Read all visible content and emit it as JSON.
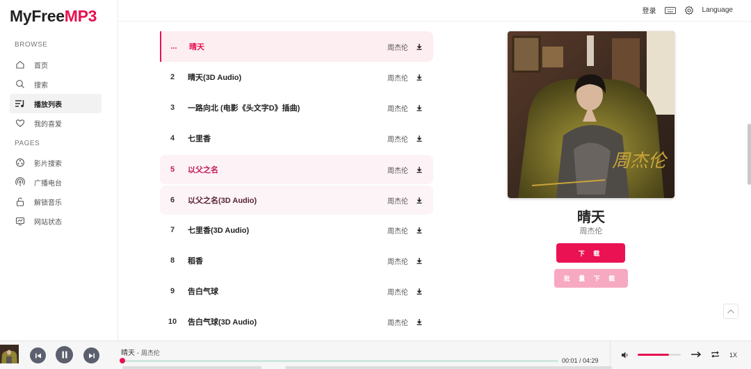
{
  "logo": {
    "text_main": "MyFree",
    "text_accent": "MP3"
  },
  "sidebar": {
    "browse_label": "BROWSE",
    "pages_label": "PAGES",
    "browse_items": [
      {
        "label": "首页",
        "icon": "home-icon"
      },
      {
        "label": "搜索",
        "icon": "search-icon"
      },
      {
        "label": "播放列表",
        "icon": "playlist-icon",
        "active": true
      },
      {
        "label": "我的喜爱",
        "icon": "heart-icon"
      }
    ],
    "page_items": [
      {
        "label": "影片搜索",
        "icon": "film-reel-icon"
      },
      {
        "label": "广播电台",
        "icon": "radio-icon"
      },
      {
        "label": "解锁音乐",
        "icon": "unlock-icon"
      },
      {
        "label": "网站状态",
        "icon": "monitor-icon"
      }
    ]
  },
  "topbar": {
    "login": "登录",
    "keyboard_icon": "keyboard-icon",
    "settings_icon": "gear-icon",
    "language": "Language"
  },
  "songs": [
    {
      "num": "...",
      "title": "晴天",
      "artist": "周杰伦"
    },
    {
      "num": "2",
      "title": "晴天(3D Audio)",
      "artist": "周杰伦"
    },
    {
      "num": "3",
      "title": "一路向北 (电影《头文字D》插曲)",
      "artist": "周杰伦"
    },
    {
      "num": "4",
      "title": "七里香",
      "artist": "周杰伦"
    },
    {
      "num": "5",
      "title": "以父之名",
      "artist": "周杰伦"
    },
    {
      "num": "6",
      "title": "以父之名(3D Audio)",
      "artist": "周杰伦"
    },
    {
      "num": "7",
      "title": "七里香(3D Audio)",
      "artist": "周杰伦"
    },
    {
      "num": "8",
      "title": "稻香",
      "artist": "周杰伦"
    },
    {
      "num": "9",
      "title": "告白气球",
      "artist": "周杰伦"
    },
    {
      "num": "10",
      "title": "告白气球(3D Audio)",
      "artist": "周杰伦"
    }
  ],
  "now_playing": {
    "title": "晴天",
    "artist": "周杰伦",
    "download_label": "下 载",
    "batch_download_label": "批 量 下 载",
    "cover_script_text": "周杰伦"
  },
  "player": {
    "track_text": "晴天",
    "separator": " - ",
    "track_artist": "周杰伦",
    "time": "00:01 / 04:29",
    "progress": 0.004,
    "volume": 0.72,
    "speed": "1X"
  },
  "colors": {
    "accent": "#e8114f",
    "batch_button": "#f6a9c0",
    "player_controls": "#5b5f6e"
  }
}
